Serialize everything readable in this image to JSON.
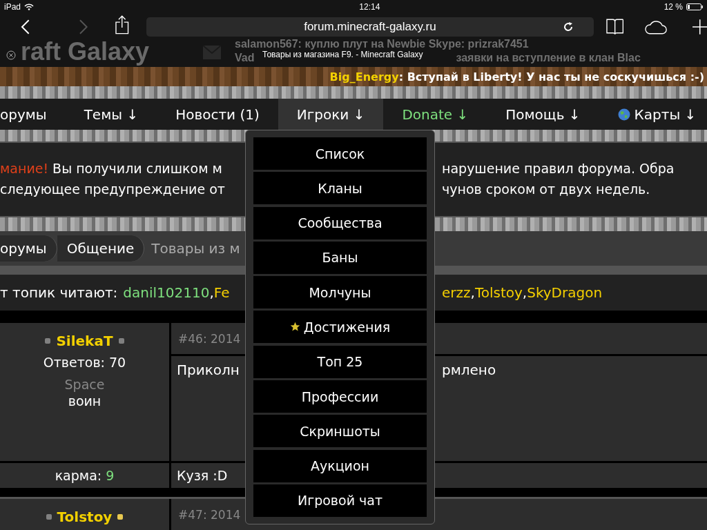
{
  "status_bar": {
    "device": "iPad",
    "time": "12:14",
    "battery": "12 %"
  },
  "toolbar": {
    "back_disabled": false,
    "forward_disabled": true,
    "url": "forum.minecraft-galaxy.ru"
  },
  "tab": {
    "title": "Товары из магазина F9. - Minecraft Galaxy"
  },
  "site_header": {
    "logo": "raft Galaxy",
    "chat": [
      {
        "parts": [
          "salamon567: куплю плут на Newbie Skype: prizrak7451"
        ]
      },
      {
        "parts": [
          "Vad",
          "заявки на вступление в клан Blac"
        ]
      }
    ]
  },
  "ticker": {
    "author": "Big_Energy",
    "message": ": Вступай в Liberty! У нас ты не соскучишься :-)"
  },
  "nav": [
    {
      "label": "орумы",
      "selected": false,
      "color": "#ffffff",
      "kind": "plain"
    },
    {
      "label": "Темы ↓",
      "selected": false,
      "color": "#ffffff",
      "kind": "plain"
    },
    {
      "label": "Новости (1)",
      "selected": false,
      "color": "#ffffff",
      "kind": "plain"
    },
    {
      "label": "Игроки ↓",
      "selected": true,
      "color": "#ffffff",
      "kind": "plain"
    },
    {
      "label": "Donate ↓",
      "selected": false,
      "color": "#7ee07e",
      "kind": "plain"
    },
    {
      "label": "Помощь ↓",
      "selected": false,
      "color": "#ffffff",
      "kind": "plain"
    },
    {
      "label": "Карты ↓",
      "selected": false,
      "color": "#ffffff",
      "kind": "globe"
    }
  ],
  "warning": {
    "label": "мание!",
    "line1_left": "Вы получили слишком м",
    "line1_right": "нарушение правил форума. Обра",
    "line2_left": "следующее предупреждение от",
    "line2_right": "чунов сроком от двух недель."
  },
  "breadcrumbs": [
    {
      "label": "орумы",
      "kind": "pill"
    },
    {
      "label": "Общение",
      "kind": "pill"
    },
    {
      "label": "Товары из м",
      "kind": "current"
    }
  ],
  "readers": {
    "label": "т топик читают:",
    "left": [
      {
        "text": "danil102110",
        "color": "#7ee07e"
      },
      {
        "text": ",",
        "color": "#ffffff"
      },
      {
        "text": "Fe",
        "color": "#f5d000"
      }
    ],
    "right": [
      {
        "text": "erzz",
        "color": "#f5d000"
      },
      {
        "text": ",",
        "color": "#ffffff"
      },
      {
        "text": "Tolstoy",
        "color": "#f5d000"
      },
      {
        "text": ",",
        "color": "#ffffff"
      },
      {
        "text": "SkyDragon",
        "color": "#f5d000"
      }
    ]
  },
  "posts": [
    {
      "author": "SilekaT",
      "dots": [
        {
          "color": "#808080"
        },
        {
          "color": "#808080"
        }
      ],
      "replies": "Ответов: 70",
      "title_line": "Space",
      "rank": "воин",
      "karma_label": "карма:",
      "karma": "9",
      "number": "#46: 2014",
      "body_left": "Приколн",
      "body_right": "рмлено",
      "signature": "Кузя :D"
    },
    {
      "author": "Tolstoy",
      "dots": [
        {
          "color": "#808080"
        },
        {
          "color": "#e8c850"
        }
      ],
      "number": "#47: 2014"
    }
  ],
  "menu": [
    {
      "label": "Список",
      "kind": "plain"
    },
    {
      "label": "Кланы",
      "kind": "plain"
    },
    {
      "label": "Сообщества",
      "kind": "plain"
    },
    {
      "label": "Баны",
      "kind": "plain"
    },
    {
      "label": "Молчуны",
      "kind": "plain"
    },
    {
      "label": "Достижения",
      "kind": "star"
    },
    {
      "label": "Топ 25",
      "kind": "plain"
    },
    {
      "label": "Профессии",
      "kind": "plain"
    },
    {
      "label": "Скриншоты",
      "kind": "plain"
    },
    {
      "label": "Аукцион",
      "kind": "plain"
    },
    {
      "label": "Игровой чат",
      "kind": "plain"
    }
  ]
}
